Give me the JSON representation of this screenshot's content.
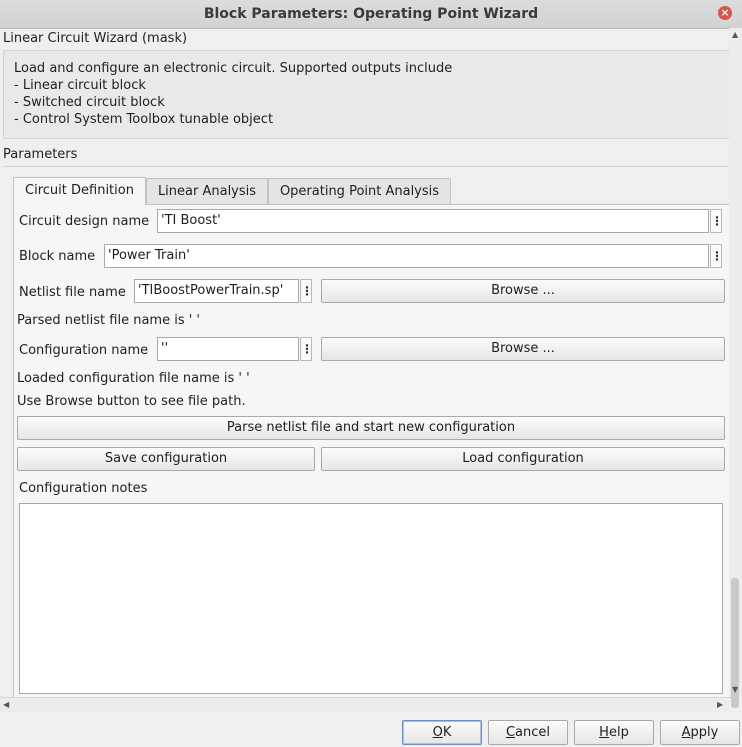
{
  "window": {
    "title": "Block Parameters: Operating Point Wizard"
  },
  "mask_title": "Linear Circuit Wizard (mask)",
  "description": [
    "Load and configure an electronic circuit. Supported outputs include",
    "- Linear circuit block",
    "- Switched circuit block",
    "- Control System Toolbox tunable object"
  ],
  "parameters_label": "Parameters",
  "tabs": [
    {
      "label": "Circuit Definition",
      "active": true
    },
    {
      "label": "Linear Analysis",
      "active": false
    },
    {
      "label": "Operating Point Analysis",
      "active": false
    }
  ],
  "circuit": {
    "design_name_label": "Circuit design name",
    "design_name_value": "'TI Boost'",
    "block_name_label": "Block name",
    "block_name_value": "'Power Train'",
    "netlist_label": "Netlist file name",
    "netlist_value": "'TIBoostPowerTrain.sp'",
    "netlist_browse": "Browse ...",
    "parsed_text": "Parsed netlist file name is ' '",
    "config_label": "Configuration name",
    "config_value": "''",
    "config_browse": "Browse ...",
    "loaded_text": "Loaded configuration file name is ' '",
    "browse_hint": "Use Browse button to see file path.",
    "parse_button": "Parse netlist file and start new configuration",
    "save_button": "Save configuration",
    "load_button": "Load configuration",
    "notes_label": "Configuration notes",
    "notes_value": ""
  },
  "buttons": {
    "ok": {
      "mnemonic": "O",
      "rest": "K"
    },
    "cancel": {
      "mnemonic": "C",
      "rest": "ancel"
    },
    "help": {
      "mnemonic": "H",
      "rest": "elp"
    },
    "apply": {
      "mnemonic": "A",
      "rest": "pply"
    }
  },
  "icons": {
    "close": "close-icon",
    "kebab": "vertical-ellipsis-icon"
  },
  "colors": {
    "close": "#d9534f",
    "default_button_border": "#6a8fc5"
  }
}
